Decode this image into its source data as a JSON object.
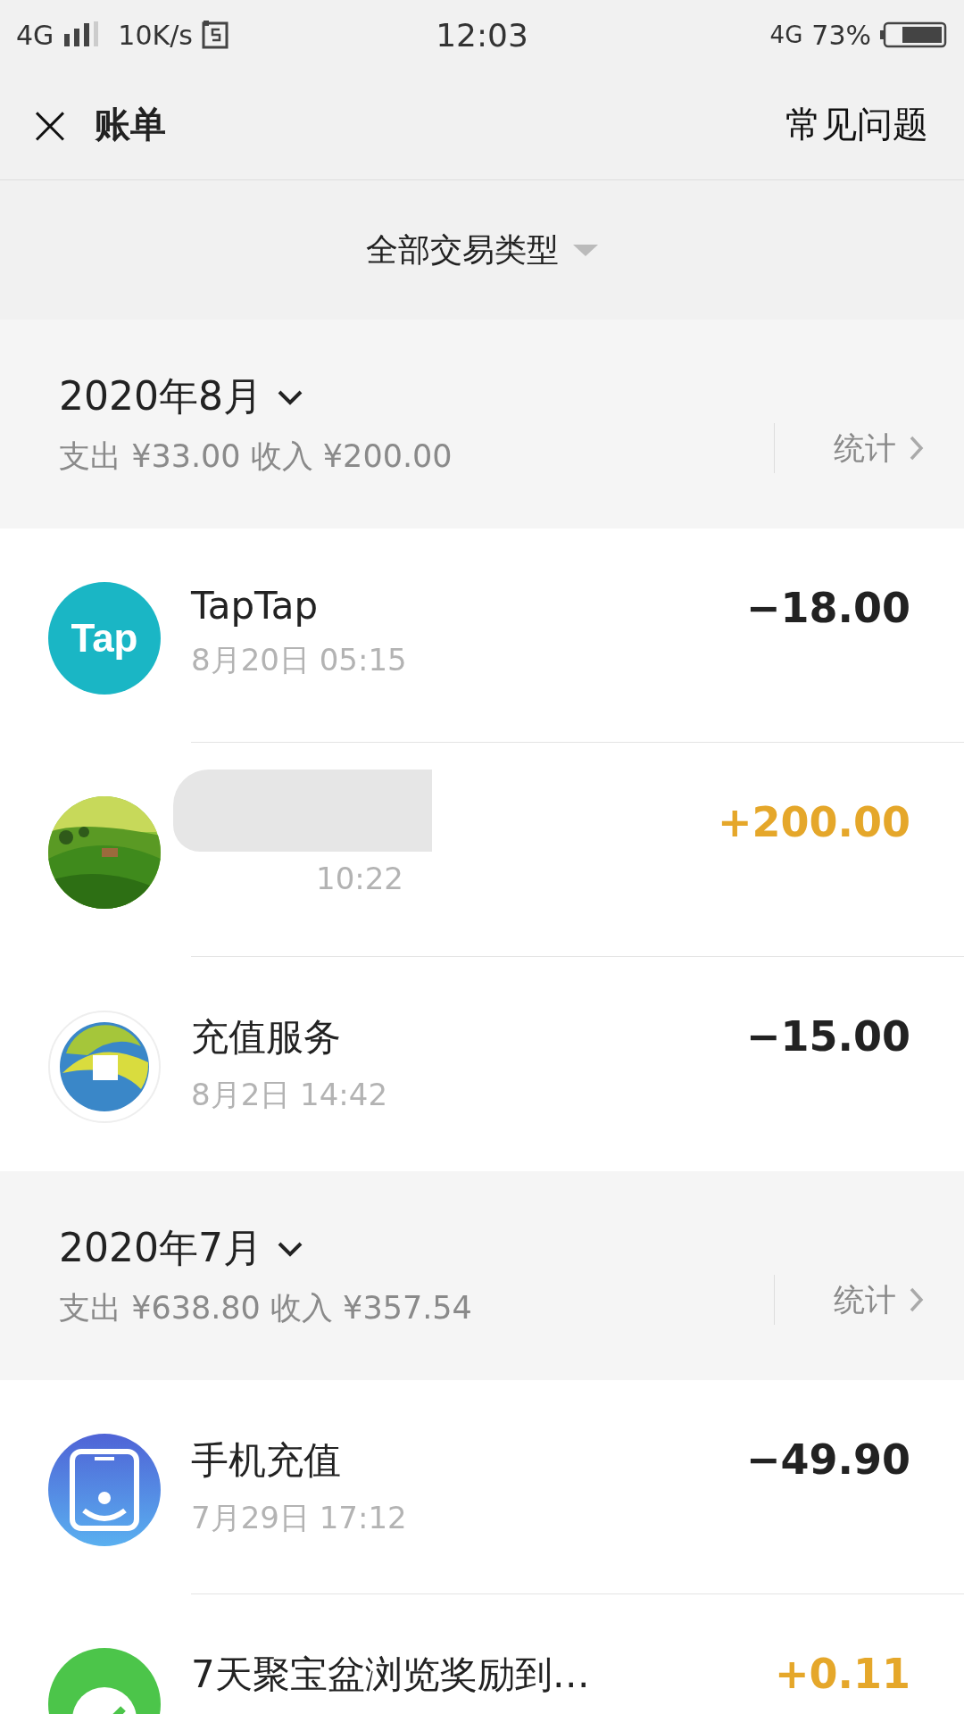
{
  "status_bar": {
    "network": "4G",
    "speed": "10K/s",
    "time": "12:03",
    "network_right": "4G",
    "battery": "73%"
  },
  "header": {
    "close": "×",
    "title": "账单",
    "faq": "常见问题"
  },
  "filter": {
    "label": "全部交易类型"
  },
  "months": [
    {
      "title": "2020年8月",
      "summary": "支出 ¥33.00 收入 ¥200.00",
      "stats": "统计",
      "transactions": [
        {
          "icon_text": "Tap",
          "name": "TapTap",
          "time": "8月20日 05:15",
          "amount": "−18.00",
          "income": false
        },
        {
          "redacted": true,
          "time": "10:22",
          "amount": "+200.00",
          "income": true
        },
        {
          "name": "充值服务",
          "time": "8月2日 14:42",
          "amount": "−15.00",
          "income": false
        }
      ]
    },
    {
      "title": "2020年7月",
      "summary": "支出 ¥638.80 收入 ¥357.54",
      "stats": "统计",
      "transactions": [
        {
          "name": "手机充值",
          "time": "7月29日 17:12",
          "amount": "−49.90",
          "income": false
        },
        {
          "name": "7天聚宝盆浏览奖励到…",
          "amount": "+0.11",
          "income": true
        }
      ]
    }
  ]
}
